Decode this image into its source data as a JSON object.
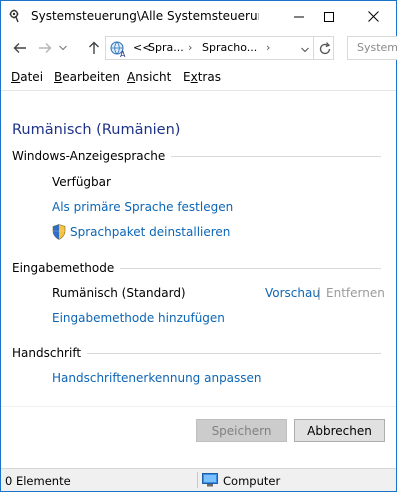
{
  "window": {
    "title": "Systemsteuerung\\Alle Systemsteuerungs...",
    "app_icon": "control-panel-icon"
  },
  "titlebar_buttons": {
    "minimize": "minimize-icon",
    "maximize": "maximize-icon",
    "close": "close-icon"
  },
  "address": {
    "overflow": "<<",
    "segment1": "Spra...",
    "segment2": "Spracho...",
    "search_placeholder": "Systems"
  },
  "menu": {
    "items": [
      {
        "label": "Datei",
        "accel": "D"
      },
      {
        "label": "Bearbeiten",
        "accel": "B"
      },
      {
        "label": "Ansicht",
        "accel": "A"
      },
      {
        "label": "Extras",
        "accel": "x"
      }
    ]
  },
  "page": {
    "title": "Rumänisch (Rumänien)"
  },
  "display_language": {
    "heading": "Windows-Anzeigesprache",
    "status": "Verfügbar",
    "set_primary_link": "Als primäre Sprache festlegen",
    "uninstall_link": "Sprachpaket deinstallieren"
  },
  "input_method": {
    "heading": "Eingabemethode",
    "method_name": "Rumänisch (Standard)",
    "preview_link": "Vorschau",
    "separator": "|",
    "remove_link": "Entfernen",
    "add_link": "Eingabemethode hinzufügen"
  },
  "handwriting": {
    "heading": "Handschrift",
    "customize_link": "Handschriftenerkennung anpassen"
  },
  "buttons": {
    "save": "Speichern",
    "cancel": "Abbrechen"
  },
  "status": {
    "items_count": "0 Elemente",
    "location": "Computer"
  },
  "colors": {
    "link": "#0c65b5",
    "title": "#1e3287",
    "window_border": "#1a73c8"
  }
}
